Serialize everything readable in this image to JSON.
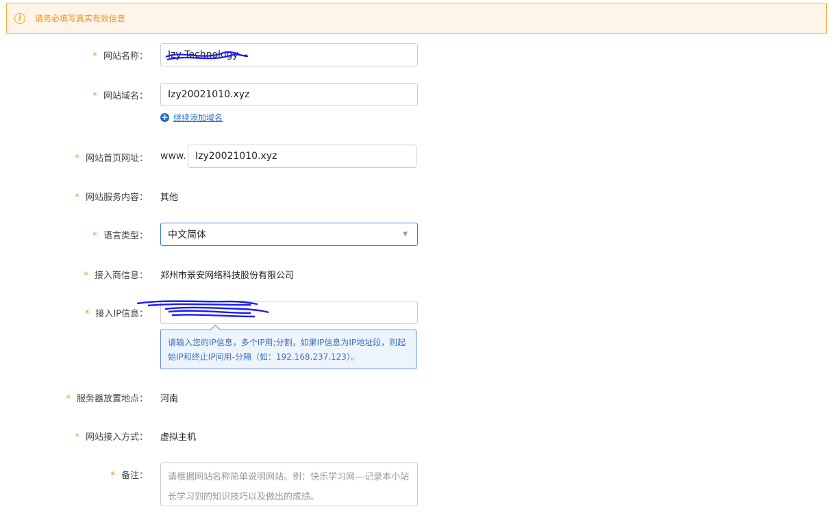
{
  "alert": {
    "text": "请务必填写真实有效信息",
    "icon": "info-icon"
  },
  "form": {
    "required_mark": "*",
    "site_name": {
      "label": "网站名称：",
      "value": "Izy Technology"
    },
    "site_domain": {
      "label": "网站域名：",
      "value": "Izy20021010.xyz",
      "add_link": "继续添加域名"
    },
    "homepage": {
      "label": "网站首页网址：",
      "prefix": "www.",
      "value": "Izy20021010.xyz"
    },
    "service_content": {
      "label": "网站服务内容：",
      "value": "其他"
    },
    "language": {
      "label": "语言类型：",
      "value": "中文简体"
    },
    "provider": {
      "label": "接入商信息：",
      "value": "郑州市景安网络科技股份有限公司"
    },
    "ip": {
      "label": "接入IP信息：",
      "value": "",
      "tooltip": "请输入您的IP信息，多个IP用;分割，如果IP信息为IP地址段，则起始IP和终止IP间用-分隔（如：192.168.237.123）。"
    },
    "server_location": {
      "label": "服务器放置地点：",
      "value": "河南"
    },
    "access_method": {
      "label": "网站接入方式：",
      "value": "虚拟主机"
    },
    "remark": {
      "label": "备注：",
      "placeholder": "请根据网站名称简单说明网站。例：快乐学习网---记录本小站长学习到的知识技巧以及做出的成绩。"
    }
  },
  "colors": {
    "accent_orange": "#f0912b",
    "link_blue": "#2a6cc2",
    "redaction_blue": "#1a1aff"
  }
}
